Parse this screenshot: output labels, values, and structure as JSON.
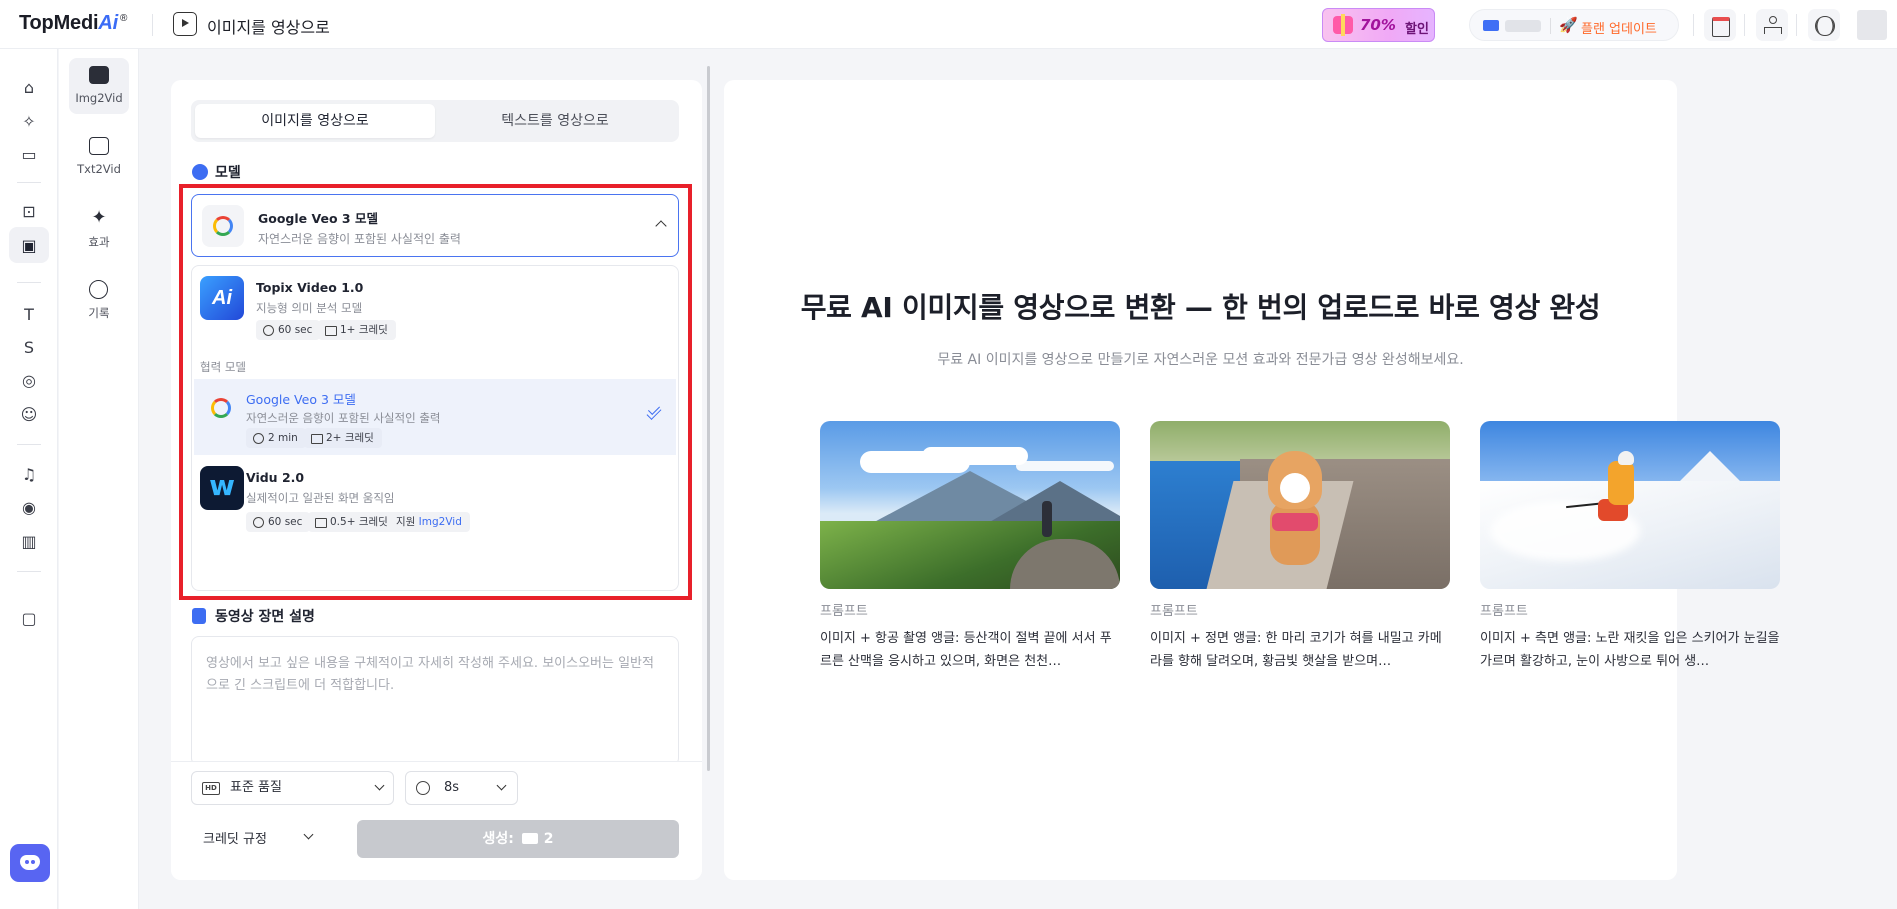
{
  "topbar": {
    "logo_main": "TopMedi",
    "logo_ai": "Ai",
    "logo_reg": "®",
    "page_title": "이미지를 영상으로",
    "promo_pct": "70%",
    "promo_text": "할인",
    "upgrade_label": "플랜 업데이트"
  },
  "subnav": {
    "items": [
      {
        "label": "Img2Vid"
      },
      {
        "label": "Txt2Vid"
      },
      {
        "label": "효과"
      },
      {
        "label": "기록"
      }
    ]
  },
  "panel": {
    "tabs": [
      {
        "label": "이미지를 영상으로"
      },
      {
        "label": "텍스트를 영상으로"
      }
    ],
    "model_section_title": "모델",
    "selected_model": {
      "name": "Google Veo 3 모델",
      "desc": "자연스러운 음향이 포함된 사실적인 출력"
    },
    "partner_label": "협력 모델",
    "options": [
      {
        "name": "Topix Video 1.0",
        "desc": "지능형 의미 분석 모델",
        "logo_text": "Ai",
        "time": "60 sec",
        "credit": "1+ 크레딧"
      },
      {
        "name": "Google Veo 3 모델",
        "desc": "자연스러운 음향이 포함된 사실적인 출력",
        "time": "2 min",
        "credit": "2+ 크레딧"
      },
      {
        "name": "Vidu 2.0",
        "desc": "실제적이고 일관된 화면 움직임",
        "time": "60 sec",
        "credit": "0.5+ 크레딧",
        "support_prefix": "지원",
        "support_value": "Img2Vid"
      }
    ],
    "scene_section_title": "동영상 장면 설명",
    "scene_placeholder": "영상에서 보고 싶은 내용을 구체적이고 자세히 작성해 주세요. 보이스오버는 일반적으로 긴 스크립트에 더 적합합니다.",
    "quality_icon": "HD",
    "quality_value": "표준 품질",
    "duration_value": "8s",
    "credit_rules_label": "크레딧 규정",
    "generate_label": "생성:",
    "generate_cost": "2"
  },
  "main": {
    "title": "무료 AI 이미지를 영상으로 변환 — 한 번의 업로드로 바로 영상 완성",
    "subtitle": "무료 AI 이미지를 영상으로 만들기로 자연스러운 모션 효과와 전문가급 영상 완성해보세요.",
    "cards": [
      {
        "prompt_label": "프롬프트",
        "prompt_text": "이미지 + 항공 촬영 앵글: 등산객이 절벽 끝에 서서 푸르른 산맥을 응시하고 있으며, 화면은 천천…"
      },
      {
        "prompt_label": "프롬프트",
        "prompt_text": "이미지 + 정면 앵글: 한 마리 코기가 혀를 내밀고 카메라를 향해 달려오며, 황금빛 햇살을 받으며…"
      },
      {
        "prompt_label": "프롬프트",
        "prompt_text": "이미지 + 측면 앵글: 노란 재킷을 입은 스키어가 눈길을 가르며 활강하고, 눈이 사방으로 튀어 생…"
      }
    ]
  },
  "colors": {
    "accent": "#3d6df2",
    "highlight_border": "#e8202a",
    "discord": "#5865f2"
  }
}
